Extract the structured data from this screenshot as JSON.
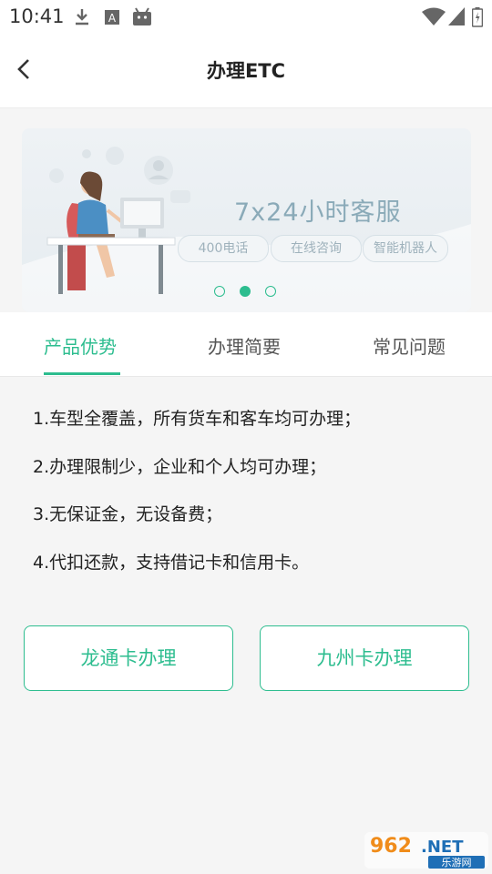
{
  "status_bar": {
    "time": "10:41",
    "icons": [
      "download-icon",
      "a-icon",
      "android-icon",
      "wifi-icon",
      "signal-icon",
      "battery-icon"
    ]
  },
  "header": {
    "title": "办理ETC",
    "back_icon": "back-arrow-icon"
  },
  "banner": {
    "headline": "7x24小时客服",
    "chips": [
      "400电话",
      "在线咨询",
      "智能机器人"
    ],
    "carousel_count": 3,
    "active_index": 1,
    "accent_color": "#2dbd8f"
  },
  "tabs": {
    "items": [
      "产品优势",
      "办理简要",
      "常见问题"
    ],
    "active_index": 0
  },
  "content": {
    "items": [
      "1.车型全覆盖，所有货车和客车均可办理；",
      "2.办理限制少，企业和个人均可办理；",
      "3.无保证金，无设备费；",
      "4.代扣还款，支持借记卡和信用卡。"
    ]
  },
  "buttons": {
    "longtong": "龙通卡办理",
    "jiuzhou": "九州卡办理"
  },
  "watermark": {
    "logo_text": "962.NET",
    "sub_text": "乐游网"
  }
}
